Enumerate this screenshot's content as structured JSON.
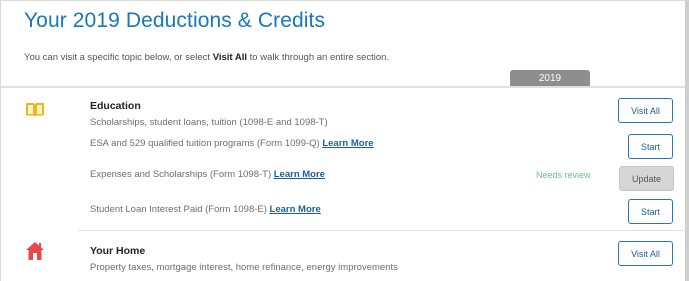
{
  "header": {
    "title": "Your 2019 Deductions & Credits",
    "intro_before": "You can visit a specific topic below, or select ",
    "intro_bold": "Visit All",
    "intro_after": " to walk through an entire section."
  },
  "year_tab": "2019",
  "sections": [
    {
      "icon": "book-icon",
      "title": "Education",
      "summary": "Scholarships, student loans, tuition (1098-E and 1098-T)",
      "visit_all_label": "Visit All",
      "topics": [
        {
          "text": "ESA and 529 qualified tuition programs (Form 1099-Q)",
          "link": "Learn More",
          "status": "",
          "button": "Start"
        },
        {
          "text": "Expenses and Scholarships (Form 1098-T)",
          "link": "Learn More",
          "status": "Needs review",
          "button": "Update"
        },
        {
          "text": "Student Loan Interest Paid (Form 1098-E)",
          "link": "Learn More",
          "status": "",
          "button": "Start"
        }
      ]
    },
    {
      "icon": "house-icon",
      "title": "Your Home",
      "summary": "Property taxes, mortgage interest, home refinance, energy improvements",
      "visit_all_label": "Visit All"
    }
  ],
  "colors": {
    "accent": "#1a76bd",
    "book": "#f2b51c",
    "house": "#e8474c",
    "status_green": "#6fbf8a"
  }
}
